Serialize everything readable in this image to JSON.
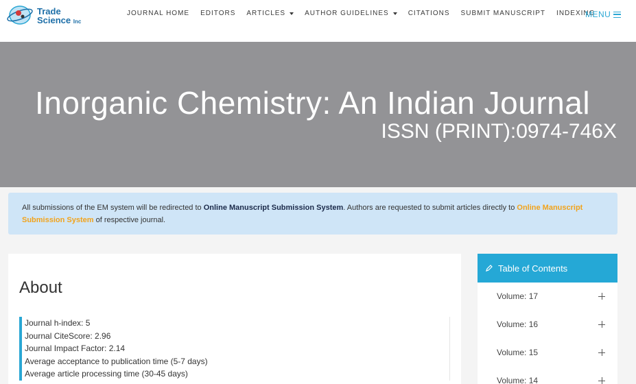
{
  "logo": {
    "line1": "Trade",
    "line2": "Science",
    "line2_suffix": "Inc"
  },
  "nav": {
    "items": [
      {
        "label": "JOURNAL HOME",
        "dropdown": false
      },
      {
        "label": "EDITORS",
        "dropdown": false
      },
      {
        "label": "ARTICLES",
        "dropdown": true
      },
      {
        "label": "AUTHOR GUIDELINES",
        "dropdown": true
      },
      {
        "label": "CITATIONS",
        "dropdown": false
      },
      {
        "label": "SUBMIT MANUSCRIPT",
        "dropdown": false
      },
      {
        "label": "INDEXING",
        "dropdown": false
      }
    ],
    "menu_label": "MENU"
  },
  "banner": {
    "title": "Inorganic Chemistry: An Indian Journal",
    "issn": "ISSN (PRINT):0974-746X"
  },
  "notice": {
    "part1": "All submissions of the EM system will be redirected to ",
    "strong": "Online Manuscript Submission System",
    "part2": ". Authors are requested to submit articles directly to ",
    "link": "Online Manuscript Submission System",
    "part3": " of respective journal."
  },
  "about": {
    "title": "About",
    "metrics": [
      "Journal h-index: 5",
      "Journal CiteScore: 2.96",
      "Journal Impact Factor: 2.14",
      "Average acceptance to publication time (5-7 days)",
      "Average article processing time (30-45 days)"
    ]
  },
  "toc": {
    "title": "Table of Contents",
    "volumes": [
      "Volume: 17",
      "Volume: 16",
      "Volume: 15",
      "Volume: 14"
    ]
  },
  "colors": {
    "accent": "#25a8d6",
    "banner": "#939396",
    "notice_bg": "#cfe5f7",
    "link": "#f2a31b"
  }
}
